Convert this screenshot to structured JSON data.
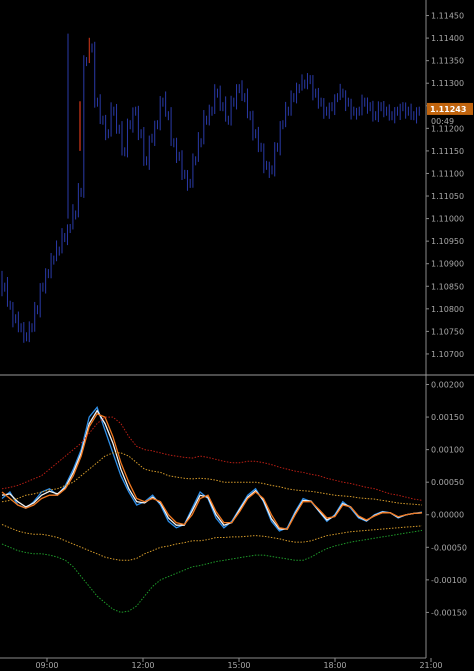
{
  "chart_data": [
    {
      "type": "bar",
      "subtype": "ohlc",
      "instrument_hint": "",
      "ylim": [
        1.1066,
        1.1148
      ],
      "yticks": [
        "1.11450",
        "1.11400",
        "1.11350",
        "1.11300",
        "1.11250",
        "1.11200",
        "1.11150",
        "1.11100",
        "1.11050",
        "1.11000",
        "1.10950",
        "1.10900",
        "1.10850",
        "1.10800",
        "1.10750",
        "1.10700"
      ],
      "price_label": "1.11243",
      "countdown_label": "00:49",
      "bar_color": "#2a3aa8",
      "highlight_bar_color": "#d93a1a",
      "label_bg_color": "#c0640e",
      "close_series": [
        1.1085,
        1.1081,
        1.1078,
        1.1076,
        1.1074,
        1.1076,
        1.108,
        1.1085,
        1.1088,
        1.1091,
        1.1093,
        1.1096,
        1.1098,
        1.1101,
        1.1106,
        1.1135,
        1.1138,
        1.1126,
        1.1122,
        1.1119,
        1.1124,
        1.112,
        1.1115,
        1.1121,
        1.1124,
        1.1119,
        1.1113,
        1.1118,
        1.1121,
        1.1126,
        1.1123,
        1.1117,
        1.1114,
        1.111,
        1.1108,
        1.1113,
        1.1117,
        1.1122,
        1.1124,
        1.1128,
        1.1125,
        1.1122,
        1.1126,
        1.1129,
        1.1127,
        1.1123,
        1.1119,
        1.1116,
        1.1112,
        1.1111,
        1.1116,
        1.1121,
        1.1124,
        1.1127,
        1.1129,
        1.113,
        1.1131,
        1.1128,
        1.1126,
        1.1124,
        1.1125,
        1.1127,
        1.1128,
        1.1126,
        1.1124,
        1.1124,
        1.1126,
        1.1125,
        1.1123,
        1.1125,
        1.1124,
        1.1123,
        1.1124,
        1.1125,
        1.1124,
        1.1123,
        1.1124
      ]
    },
    {
      "type": "line",
      "ylim": [
        -0.0022,
        0.0021
      ],
      "yticks": [
        "0.00200",
        "0.00150",
        "0.00100",
        "0.00050",
        "0.00000",
        "-0.00050",
        "-0.00100",
        "-0.00150"
      ],
      "xticks": [
        "09:00",
        "12:00",
        "15:00",
        "18:00",
        "21:00"
      ],
      "series": [
        {
          "color": "#2f8fe8",
          "values": [
            0.00025,
            0.00035,
            0.00015,
            0.0001,
            0.0002,
            0.00035,
            0.0004,
            0.0003,
            0.00045,
            0.0007,
            0.001,
            0.0015,
            0.00165,
            0.0013,
            0.00095,
            0.0006,
            0.00035,
            0.00015,
            0.0002,
            0.0003,
            0.00015,
            -0.0001,
            -0.0002,
            -0.00015,
            0.0001,
            0.00035,
            0.00025,
            -5e-05,
            -0.0002,
            -0.0001,
            0.0001,
            0.0003,
            0.0004,
            0.0002,
            -0.0001,
            -0.00025,
            -0.0002,
            5e-05,
            0.00025,
            0.0002,
            5e-05,
            -0.0001,
            0.0,
            0.0002,
            0.0001,
            -5e-05,
            -0.0001,
            0.0,
            5e-05,
            3e-05,
            -5e-05,
            0.0,
            2e-05,
            4e-05
          ]
        },
        {
          "color": "#f2f2f2",
          "values": [
            0.0003,
            0.00032,
            0.0002,
            0.00012,
            0.00018,
            0.0003,
            0.00036,
            0.00032,
            0.00042,
            0.00065,
            0.00095,
            0.0014,
            0.0016,
            0.0014,
            0.0011,
            0.0007,
            0.0004,
            0.0002,
            0.00018,
            0.00027,
            0.00018,
            -5e-05,
            -0.00016,
            -0.00016,
            6e-05,
            0.0003,
            0.00027,
            0.0,
            -0.00016,
            -0.00012,
            8e-05,
            0.00027,
            0.00037,
            0.00022,
            -6e-05,
            -0.00022,
            -0.00022,
            2e-05,
            0.00022,
            0.00021,
            6e-05,
            -8e-05,
            -2e-05,
            0.00017,
            0.00012,
            -3e-05,
            -9e-05,
            -1e-05,
            4e-05,
            3e-05,
            -4e-05,
            0.0,
            2e-05,
            3e-05
          ]
        },
        {
          "color": "#f07820",
          "values": [
            0.00035,
            0.00025,
            0.00015,
            0.0001,
            0.00015,
            0.00025,
            0.0003,
            0.0003,
            0.0004,
            0.0006,
            0.0009,
            0.00135,
            0.00155,
            0.0015,
            0.0012,
            0.0008,
            0.0005,
            0.00025,
            0.0002,
            0.00025,
            0.0002,
            0.0,
            -0.00012,
            -0.00015,
            0.0,
            0.00025,
            0.0003,
            5e-05,
            -0.00012,
            -0.00012,
            5e-05,
            0.00025,
            0.00035,
            0.00025,
            0.0,
            -0.0002,
            -0.00022,
            0.0,
            0.0002,
            0.0002,
            8e-05,
            -5e-05,
            -3e-05,
            0.00015,
            0.00012,
            -2e-05,
            -8e-05,
            -2e-05,
            3e-05,
            3e-05,
            -3e-05,
            0.0,
            2e-05,
            3e-05
          ]
        },
        {
          "color": "#b81e14",
          "dashed": true,
          "values": [
            0.0004,
            0.00042,
            0.00045,
            0.0005,
            0.00055,
            0.0006,
            0.0007,
            0.0008,
            0.0009,
            0.001,
            0.0011,
            0.00125,
            0.0014,
            0.0015,
            0.0015,
            0.0014,
            0.0012,
            0.00105,
            0.001,
            0.00098,
            0.00095,
            0.00092,
            0.0009,
            0.00088,
            0.00087,
            0.0009,
            0.00088,
            0.00085,
            0.00082,
            0.0008,
            0.0008,
            0.00082,
            0.00082,
            0.0008,
            0.00077,
            0.00073,
            0.0007,
            0.00067,
            0.00065,
            0.00062,
            0.0006,
            0.00056,
            0.00053,
            0.0005,
            0.00048,
            0.00045,
            0.00042,
            0.0004,
            0.00036,
            0.00032,
            0.0003,
            0.00027,
            0.00024,
            0.00022
          ]
        },
        {
          "color": "#d49a2a",
          "dashed": true,
          "values": [
            0.0002,
            0.00022,
            0.00025,
            0.0003,
            0.00032,
            0.00035,
            0.00038,
            0.0004,
            0.00045,
            0.0005,
            0.0006,
            0.0007,
            0.0008,
            0.0009,
            0.00095,
            0.00095,
            0.0009,
            0.0008,
            0.0007,
            0.00067,
            0.00065,
            0.0006,
            0.00058,
            0.00056,
            0.00055,
            0.00056,
            0.00055,
            0.00053,
            0.0005,
            0.0005,
            0.0005,
            0.0005,
            0.0005,
            0.00048,
            0.00045,
            0.00043,
            0.0004,
            0.00038,
            0.00037,
            0.00036,
            0.00034,
            0.00032,
            0.0003,
            0.00029,
            0.00028,
            0.00026,
            0.00025,
            0.00024,
            0.00022,
            0.0002,
            0.00018,
            0.00017,
            0.00016,
            0.00015
          ]
        },
        {
          "color": "#d49a2a",
          "dashed": true,
          "values": [
            -0.00015,
            -0.0002,
            -0.00025,
            -0.00028,
            -0.0003,
            -0.0003,
            -0.00032,
            -0.00035,
            -0.0004,
            -0.00045,
            -0.0005,
            -0.00055,
            -0.0006,
            -0.00065,
            -0.00068,
            -0.0007,
            -0.0007,
            -0.00067,
            -0.0006,
            -0.00055,
            -0.0005,
            -0.00048,
            -0.00045,
            -0.00043,
            -0.0004,
            -0.0004,
            -0.00038,
            -0.00035,
            -0.00035,
            -0.00034,
            -0.00034,
            -0.00033,
            -0.00032,
            -0.00033,
            -0.00035,
            -0.00037,
            -0.0004,
            -0.00042,
            -0.00042,
            -0.0004,
            -0.00036,
            -0.00032,
            -0.0003,
            -0.00028,
            -0.00026,
            -0.00025,
            -0.00024,
            -0.00023,
            -0.00022,
            -0.00021,
            -0.0002,
            -0.00019,
            -0.00018,
            -0.00017
          ]
        },
        {
          "color": "#1e9a2a",
          "dashed": true,
          "values": [
            -0.00045,
            -0.0005,
            -0.00055,
            -0.00058,
            -0.0006,
            -0.0006,
            -0.00062,
            -0.00065,
            -0.0007,
            -0.0008,
            -0.00095,
            -0.0011,
            -0.00125,
            -0.00135,
            -0.00145,
            -0.0015,
            -0.00148,
            -0.0014,
            -0.00125,
            -0.0011,
            -0.001,
            -0.00095,
            -0.0009,
            -0.00085,
            -0.0008,
            -0.00078,
            -0.00075,
            -0.00072,
            -0.0007,
            -0.00068,
            -0.00066,
            -0.00064,
            -0.00062,
            -0.00062,
            -0.00064,
            -0.00066,
            -0.00068,
            -0.0007,
            -0.0007,
            -0.00065,
            -0.00058,
            -0.00052,
            -0.00048,
            -0.00045,
            -0.00042,
            -0.0004,
            -0.00038,
            -0.00036,
            -0.00034,
            -0.00032,
            -0.0003,
            -0.00028,
            -0.00026,
            -0.00024
          ]
        }
      ]
    }
  ],
  "colors": {
    "background": "#000000",
    "separator": "#9a9a9a",
    "text": "#a8a8a8",
    "axis_line": "#8a8a8a"
  }
}
